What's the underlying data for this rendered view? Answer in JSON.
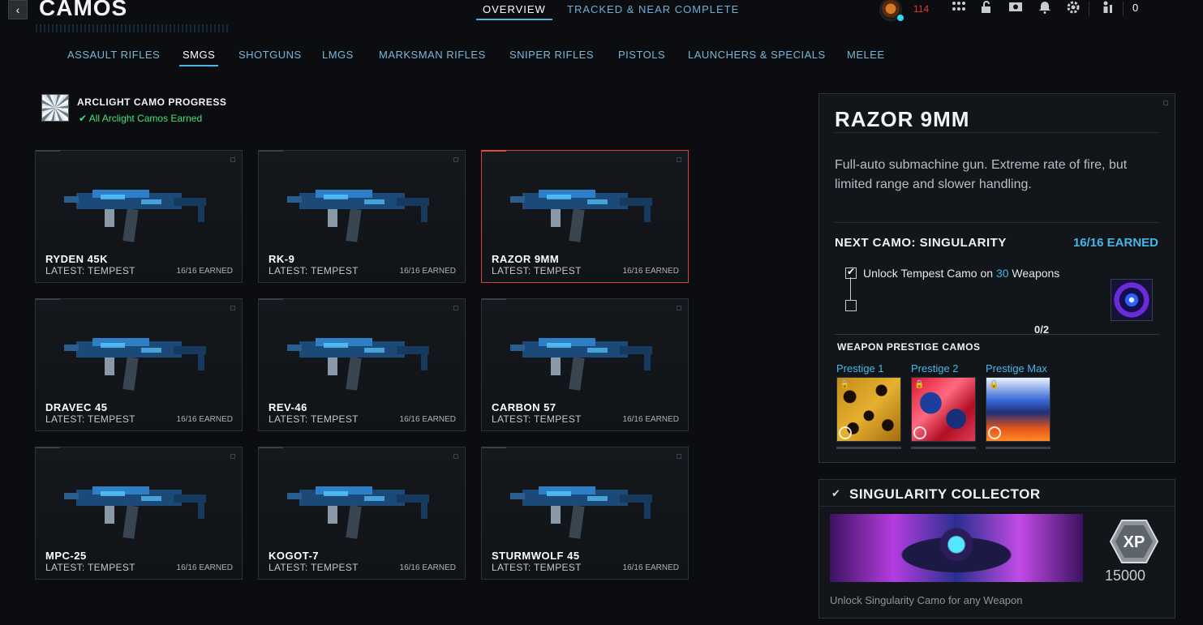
{
  "header": {
    "title": "CAMOS",
    "tabs": [
      {
        "label": "OVERVIEW",
        "active": true
      },
      {
        "label": "TRACKED & NEAR COMPLETE",
        "active": false
      }
    ],
    "level": "114",
    "currency": "0",
    "icons": [
      "profile-emblem",
      "apps-grid-icon",
      "unlock-icon",
      "theater-icon",
      "notification-bell-icon",
      "settings-gear-icon",
      "party-icon"
    ]
  },
  "categories": [
    {
      "label": "ASSAULT RIFLES",
      "active": false
    },
    {
      "label": "SMGS",
      "active": true
    },
    {
      "label": "SHOTGUNS",
      "active": false
    },
    {
      "label": "LMGS",
      "active": false
    },
    {
      "label": "MARKSMAN RIFLES",
      "active": false
    },
    {
      "label": "SNIPER RIFLES",
      "active": false
    },
    {
      "label": "PISTOLS",
      "active": false
    },
    {
      "label": "LAUNCHERS & SPECIALS",
      "active": false
    },
    {
      "label": "MELEE",
      "active": false
    }
  ],
  "arclight": {
    "title": "ARCLIGHT CAMO PROGRESS",
    "status": "All Arclight Camos Earned"
  },
  "weapons": [
    {
      "name": "RYDEN 45K",
      "latest": "LATEST: TEMPEST",
      "earned": "16/16 EARNED",
      "selected": false
    },
    {
      "name": "RK-9",
      "latest": "LATEST: TEMPEST",
      "earned": "16/16 EARNED",
      "selected": false
    },
    {
      "name": "RAZOR 9MM",
      "latest": "LATEST: TEMPEST",
      "earned": "16/16 EARNED",
      "selected": true
    },
    {
      "name": "DRAVEC 45",
      "latest": "LATEST: TEMPEST",
      "earned": "16/16 EARNED",
      "selected": false
    },
    {
      "name": "REV-46",
      "latest": "LATEST: TEMPEST",
      "earned": "16/16 EARNED",
      "selected": false
    },
    {
      "name": "CARBON 57",
      "latest": "LATEST: TEMPEST",
      "earned": "16/16 EARNED",
      "selected": false
    },
    {
      "name": "MPC-25",
      "latest": "LATEST: TEMPEST",
      "earned": "16/16 EARNED",
      "selected": false
    },
    {
      "name": "KOGOT-7",
      "latest": "LATEST: TEMPEST",
      "earned": "16/16 EARNED",
      "selected": false
    },
    {
      "name": "STURMWOLF 45",
      "latest": "LATEST: TEMPEST",
      "earned": "16/16 EARNED",
      "selected": false
    }
  ],
  "detail": {
    "title": "RAZOR 9MM",
    "description": "Full-auto submachine gun. Extreme rate of fire, but limited range and slower handling.",
    "next_camo_label": "NEXT CAMO: SINGULARITY",
    "earned": "16/16 EARNED",
    "challenge": {
      "prefix": "Unlock Tempest Camo on ",
      "highlight": "30",
      "suffix": " Weapons",
      "progress": "0/2",
      "progress_fraction": 0
    },
    "prestige_header": "WEAPON PRESTIGE CAMOS",
    "prestige": [
      {
        "label": "Prestige 1"
      },
      {
        "label": "Prestige 2"
      },
      {
        "label": "Prestige Max"
      }
    ]
  },
  "collector": {
    "title": "SINGULARITY COLLECTOR",
    "xp": "15000",
    "xp_badge": "XP",
    "description": "Unlock Singularity Camo for any Weapon"
  },
  "colors": {
    "accent": "#47b6e6",
    "selected_border": "#d8423a",
    "success": "#45e07a",
    "level": "#e8373b"
  }
}
